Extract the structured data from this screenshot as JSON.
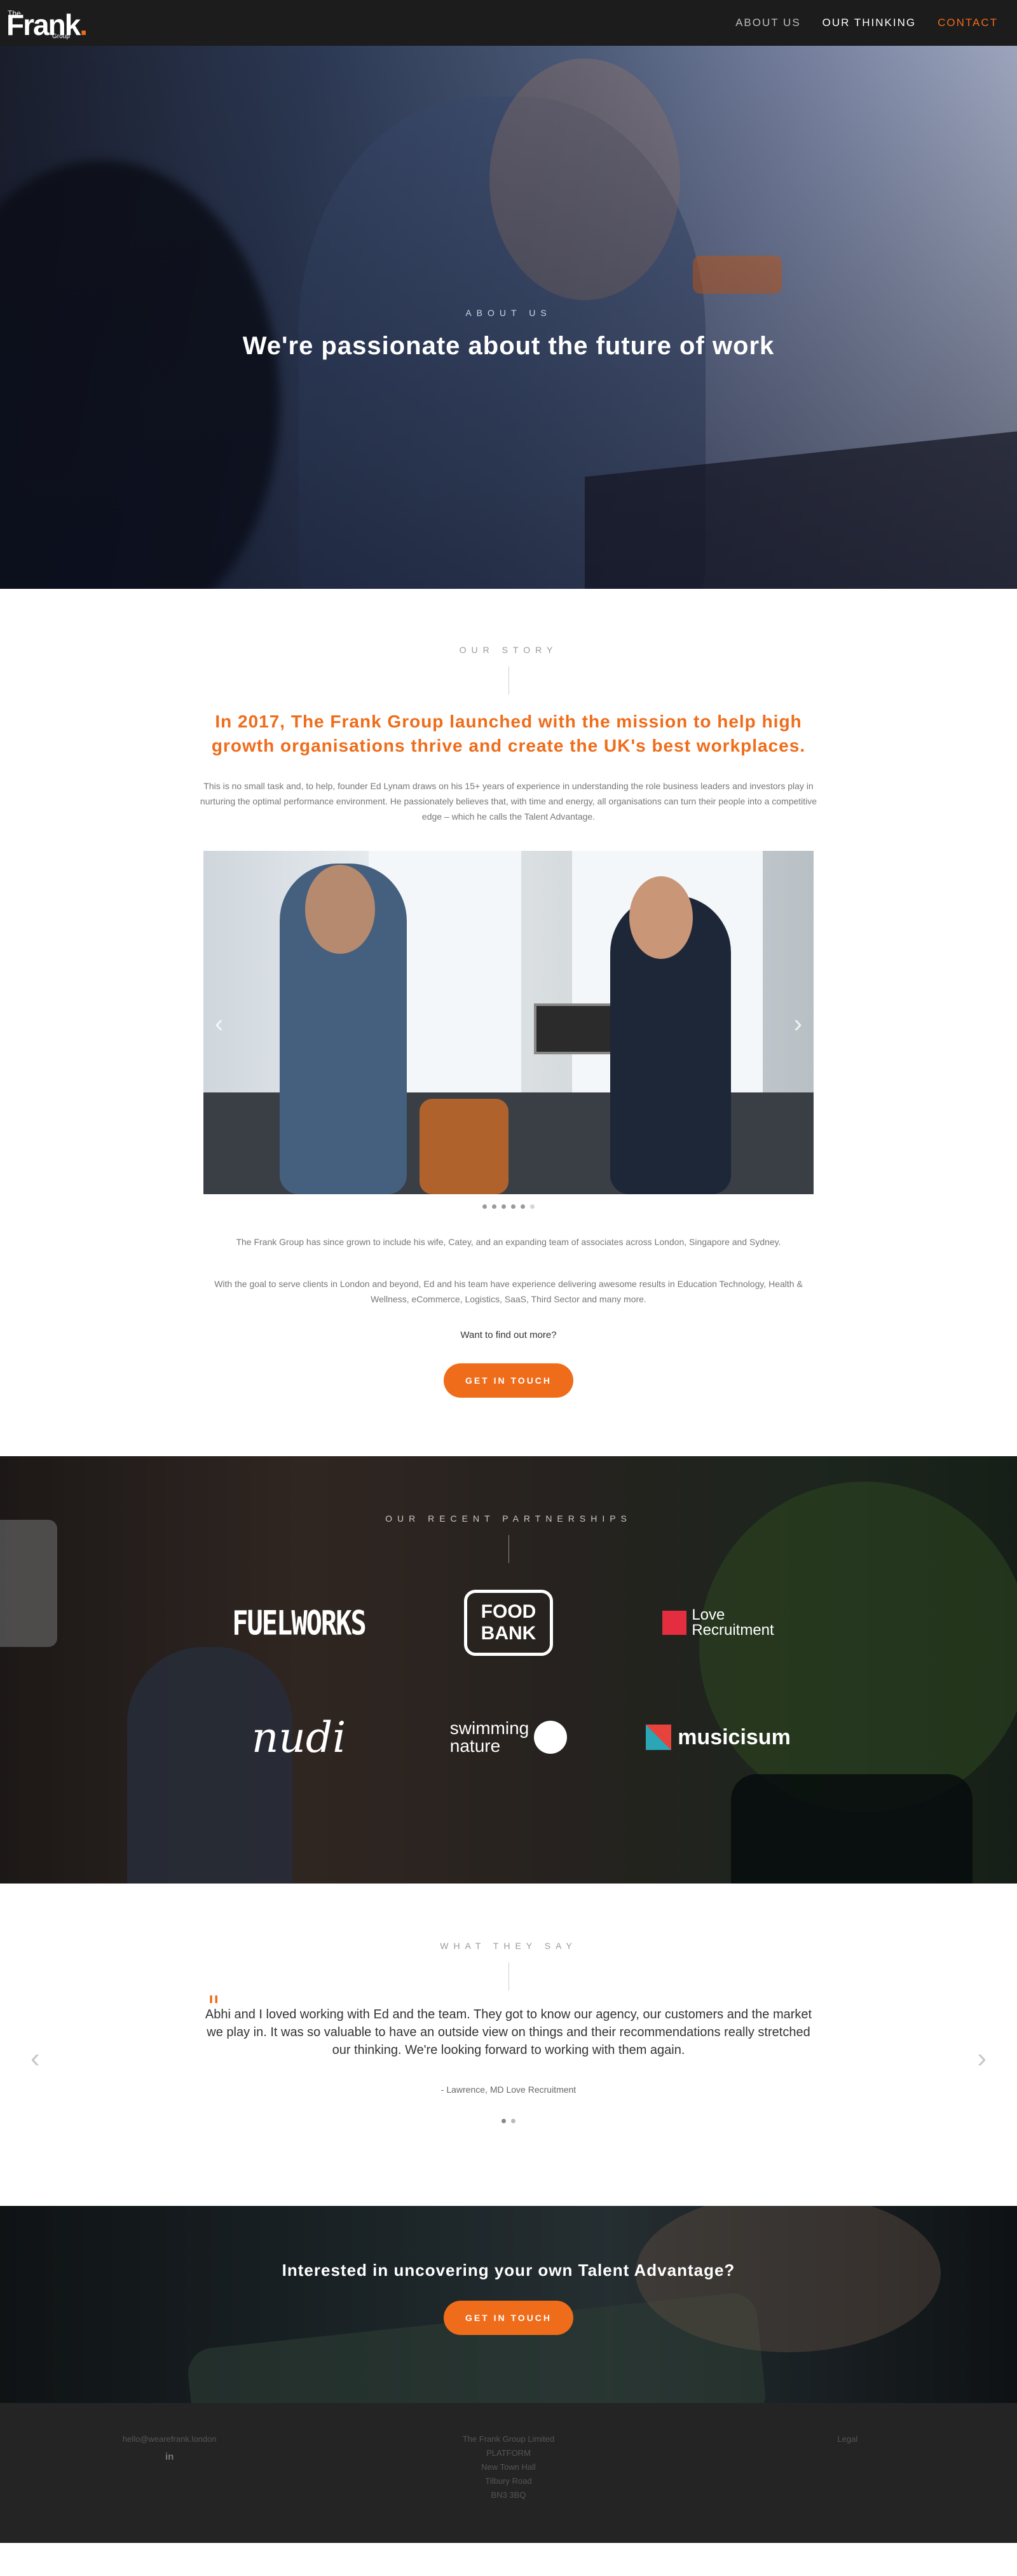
{
  "nav": {
    "logo_the": "The",
    "logo_frank": "Frank",
    "logo_group": "Group",
    "links": [
      "ABOUT US",
      "OUR THINKING",
      "CONTACT"
    ]
  },
  "hero": {
    "eyebrow": "ABOUT US",
    "title": "We're passionate about the future of work"
  },
  "story": {
    "eyebrow": "OUR STORY",
    "headline": "In 2017, The Frank Group launched with the mission to help high growth organisations thrive and create the UK's best workplaces.",
    "intro": "This is no small task and, to help, founder Ed Lynam draws on his 15+ years of experience in understanding the role business leaders and investors play in nurturing the optimal performance environment. He passionately believes that, with time and energy, all organisations can turn their people into a competitive edge – which he calls the Talent Advantage.",
    "carousel_slides": 6,
    "carousel_active": 6,
    "para1": "The Frank Group has since grown to include his wife, Catey, and an expanding team of associates across London, Singapore and Sydney.",
    "para2": "With the goal to serve clients in London and beyond, Ed and his team have experience delivering awesome results in Education Technology, Health & Wellness, eCommerce, Logistics, SaaS, Third Sector and many more.",
    "want": "Want to find out more?",
    "button": "GET IN TOUCH"
  },
  "partners": {
    "eyebrow": "OUR RECENT PARTNERSHIPS",
    "logos": {
      "fuelworks": "FUELWORKS",
      "foodbank_1": "FOOD",
      "foodbank_2": "BANK",
      "love_1": "Love",
      "love_2": "Recruitment",
      "nudi": "nudi",
      "swim_1": "swimming",
      "swim_2": "nature",
      "musicisum": "musicisum"
    }
  },
  "testimonials": {
    "eyebrow": "WHAT THEY SAY",
    "quote": "Abhi and I loved working with Ed and the team. They got to know our agency, our customers and the market we play in. It was so valuable to have an outside view on things and their recommendations really stretched our thinking. We're looking forward to working with them again.",
    "author": "- Lawrence, MD Love Recruitment",
    "slides": 2,
    "active": 1
  },
  "cta": {
    "title": "Interested in uncovering your own Talent Advantage?",
    "button": "GET IN TOUCH"
  },
  "footer": {
    "email": "hello@wearefrank.london",
    "linkedin": "in",
    "address": [
      "The Frank Group Limited",
      "PLATFORM",
      "New Town Hall",
      "Tilbury Road",
      "BN3 3BQ"
    ],
    "legal": "Legal"
  },
  "colors": {
    "accent": "#ef6c1a",
    "nav_bg": "#1c1c1c",
    "footer_bg": "#242424"
  }
}
